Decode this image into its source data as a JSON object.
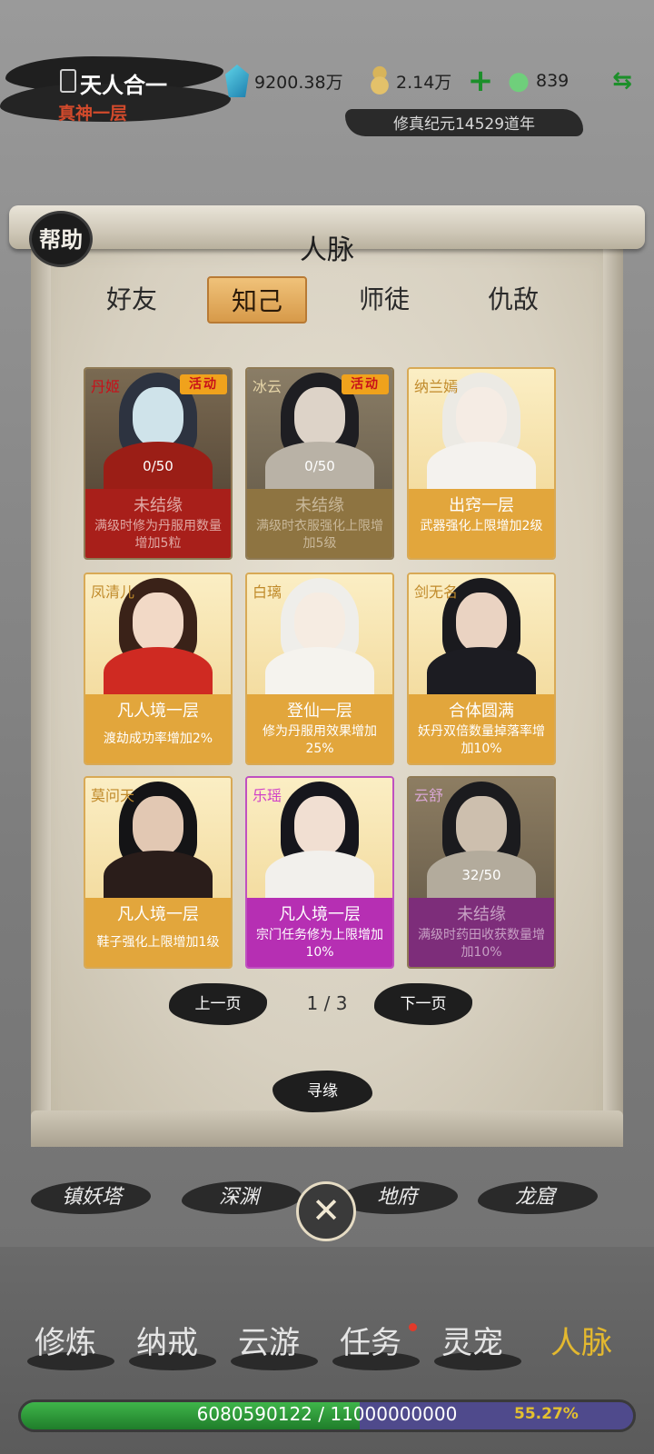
{
  "player": {
    "name": "天人合一",
    "realm": "真神一层"
  },
  "resources": {
    "spirit_stone": "9200.38万",
    "gourd": "2.14万",
    "jade": "839",
    "era": "修真纪元14529道年"
  },
  "panel": {
    "help_label": "帮助",
    "title": "人脉",
    "tabs": [
      {
        "label": "好友",
        "active": false
      },
      {
        "label": "知己",
        "active": true
      },
      {
        "label": "师徒",
        "active": false
      },
      {
        "label": "仇敌",
        "active": false
      }
    ]
  },
  "cards": [
    {
      "name": "丹姬",
      "badge": "活动",
      "progress": "0/50",
      "stage": "未结缘",
      "effect": "满级时修为丹服用数量增加5粒"
    },
    {
      "name": "冰云",
      "badge": "活动",
      "progress": "0/50",
      "stage": "未结缘",
      "effect": "满级时衣服强化上限增加5级"
    },
    {
      "name": "纳兰嫣",
      "badge": "",
      "progress": "",
      "stage": "出窍一层",
      "effect": "武器强化上限增加2级"
    },
    {
      "name": "凤清儿",
      "badge": "",
      "progress": "",
      "stage": "凡人境一层",
      "effect": "渡劫成功率增加2%"
    },
    {
      "name": "白璃",
      "badge": "",
      "progress": "",
      "stage": "登仙一层",
      "effect": "修为丹服用效果增加25%"
    },
    {
      "name": "剑无名",
      "badge": "",
      "progress": "",
      "stage": "合体圆满",
      "effect": "妖丹双倍数量掉落率增加10%"
    },
    {
      "name": "莫问天",
      "badge": "",
      "progress": "",
      "stage": "凡人境一层",
      "effect": "鞋子强化上限增加1级"
    },
    {
      "name": "乐瑶",
      "badge": "",
      "progress": "",
      "stage": "凡人境一层",
      "effect": "宗门任务修为上限增加10%"
    },
    {
      "name": "云舒",
      "badge": "",
      "progress": "32/50",
      "stage": "未结缘",
      "effect": "满级时药田收获数量增加10%"
    }
  ],
  "pager": {
    "prev": "上一页",
    "page": "1 / 3",
    "next": "下一页"
  },
  "seek_label": "寻缘",
  "locations": [
    "镇妖塔",
    "深渊",
    "地府",
    "龙窟"
  ],
  "close_icon": "close-icon",
  "nav": [
    {
      "label": "修炼",
      "active": false
    },
    {
      "label": "纳戒",
      "active": false
    },
    {
      "label": "云游",
      "active": false
    },
    {
      "label": "任务",
      "active": false,
      "notification": true
    },
    {
      "label": "灵宠",
      "active": false
    },
    {
      "label": "人脉",
      "active": true
    }
  ],
  "xp": {
    "text": "6080590122 / 11000000000",
    "percent": "55.27%",
    "fraction": 0.5527
  },
  "colors": {
    "accent_gold": "#e3b82f",
    "active_tab": "#d79a4a",
    "locked_red": "#a81f1a",
    "card_gold": "#e2a63c",
    "card_purple": "#b62fb3",
    "locked_dark_purple": "#7d2d7a",
    "xp_green": "#2f9e3b"
  }
}
